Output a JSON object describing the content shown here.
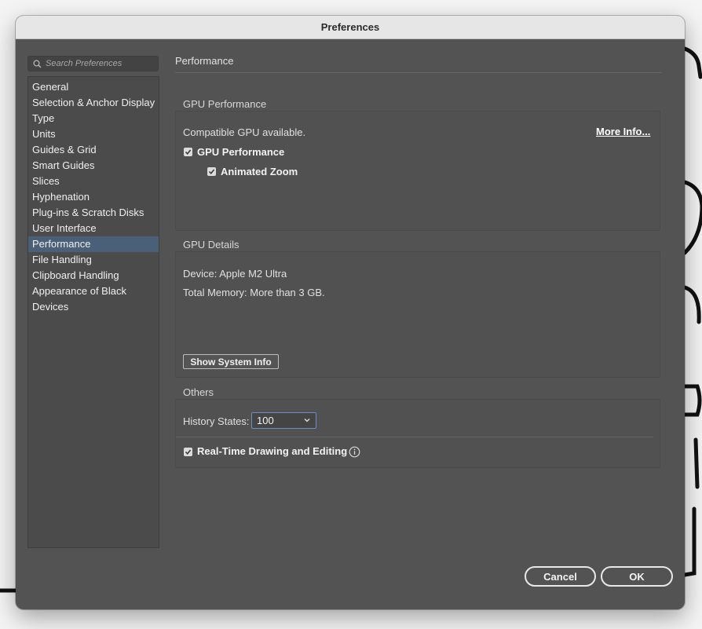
{
  "window": {
    "title": "Preferences"
  },
  "search": {
    "placeholder": "Search Preferences",
    "icon": "search-icon"
  },
  "sidebar": {
    "items": [
      {
        "label": "General",
        "active": false
      },
      {
        "label": "Selection & Anchor Display",
        "active": false
      },
      {
        "label": "Type",
        "active": false
      },
      {
        "label": "Units",
        "active": false
      },
      {
        "label": "Guides & Grid",
        "active": false
      },
      {
        "label": "Smart Guides",
        "active": false
      },
      {
        "label": "Slices",
        "active": false
      },
      {
        "label": "Hyphenation",
        "active": false
      },
      {
        "label": "Plug-ins & Scratch Disks",
        "active": false
      },
      {
        "label": "User Interface",
        "active": false
      },
      {
        "label": "Performance",
        "active": true
      },
      {
        "label": "File Handling",
        "active": false
      },
      {
        "label": "Clipboard Handling",
        "active": false
      },
      {
        "label": "Appearance of Black",
        "active": false
      },
      {
        "label": "Devices",
        "active": false
      }
    ]
  },
  "main": {
    "title": "Performance",
    "gpu_performance": {
      "title": "GPU Performance",
      "status": "Compatible GPU available.",
      "more_info": "More Info...",
      "gpu_checkbox": {
        "label": "GPU Performance",
        "checked": true
      },
      "zoom_checkbox": {
        "label": "Animated Zoom",
        "checked": true
      }
    },
    "gpu_details": {
      "title": "GPU Details",
      "device": "Device: Apple M2 Ultra",
      "memory": "Total Memory:  More than 3 GB.",
      "show_system_info": "Show System Info"
    },
    "others": {
      "title": "Others",
      "history_label": "History States:",
      "history_value": "100",
      "realtime_checkbox": {
        "label": "Real-Time Drawing and Editing",
        "checked": true
      },
      "info_icon": "info-icon"
    }
  },
  "footer": {
    "cancel": "Cancel",
    "ok": "OK"
  },
  "colors": {
    "window_bg": "#535353",
    "selected_item": "#4a6078",
    "titlebar": "#e6e6e6"
  }
}
